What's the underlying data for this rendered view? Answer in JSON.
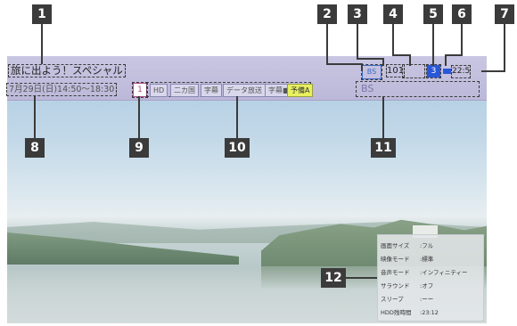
{
  "banner": {
    "program_title": "旅に出よう！スペシャル",
    "air_time": "7月29日(日)14:50～18:30",
    "program_number": "1",
    "tags": [
      "HD",
      "二カ国",
      "字幕",
      "データ放送",
      "字幕■",
      "予備A"
    ],
    "broadcast_type": "BS",
    "channel": "101",
    "sound_channel": "3",
    "clock": "22:5",
    "network_label": "BS"
  },
  "info_panel": {
    "rows": [
      {
        "key": "画面サイズ",
        "value": ":フル"
      },
      {
        "key": "映像モード",
        "value": ":標準"
      },
      {
        "key": "音声モード",
        "value": ":インフィニティー"
      },
      {
        "key": "サラウンド",
        "value": ":オフ"
      },
      {
        "key": "スリープ",
        "value": ":ーー"
      },
      {
        "key": "HDD残時間",
        "value": ":23:12"
      }
    ]
  },
  "callouts": [
    "1",
    "2",
    "3",
    "4",
    "5",
    "6",
    "7",
    "8",
    "9",
    "10",
    "11",
    "12"
  ],
  "colors": {
    "banner": "#c3c0de",
    "badge": "#3b3b3b",
    "sound_badge": "#2a57d8",
    "highlight_tag": "#e8f060"
  }
}
